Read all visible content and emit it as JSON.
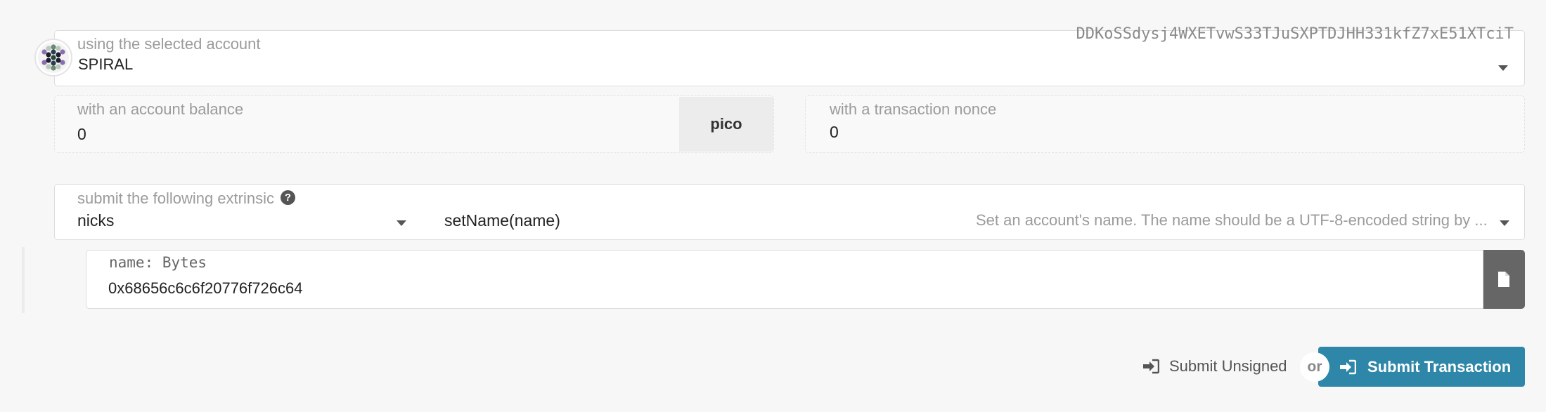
{
  "account": {
    "label": "using the selected account",
    "name": "SPIRAL",
    "address": "DDKoSSdysj4WXETvwS33TJuSXPTDJHH331kfZ7xE51XTciT"
  },
  "balance": {
    "label": "with an account balance",
    "value": "0",
    "unit": "pico"
  },
  "nonce": {
    "label": "with a transaction nonce",
    "value": "0"
  },
  "extrinsic": {
    "label": "submit the following extrinsic",
    "help_icon": "question-circle-icon",
    "module": "nicks",
    "method": "setName(name)",
    "description": "Set an account's name. The name should be a UTF-8-encoded string by ..."
  },
  "param": {
    "label": "name: Bytes",
    "value": "0x68656c6c6f20776f726c64",
    "file_icon": "file-icon"
  },
  "actions": {
    "unsigned_label": "Submit Unsigned",
    "or_label": "or",
    "submit_label": "Submit Transaction",
    "submit_icon": "sign-in-icon"
  },
  "colors": {
    "accent": "#2e87a8",
    "file_button": "#666666"
  }
}
